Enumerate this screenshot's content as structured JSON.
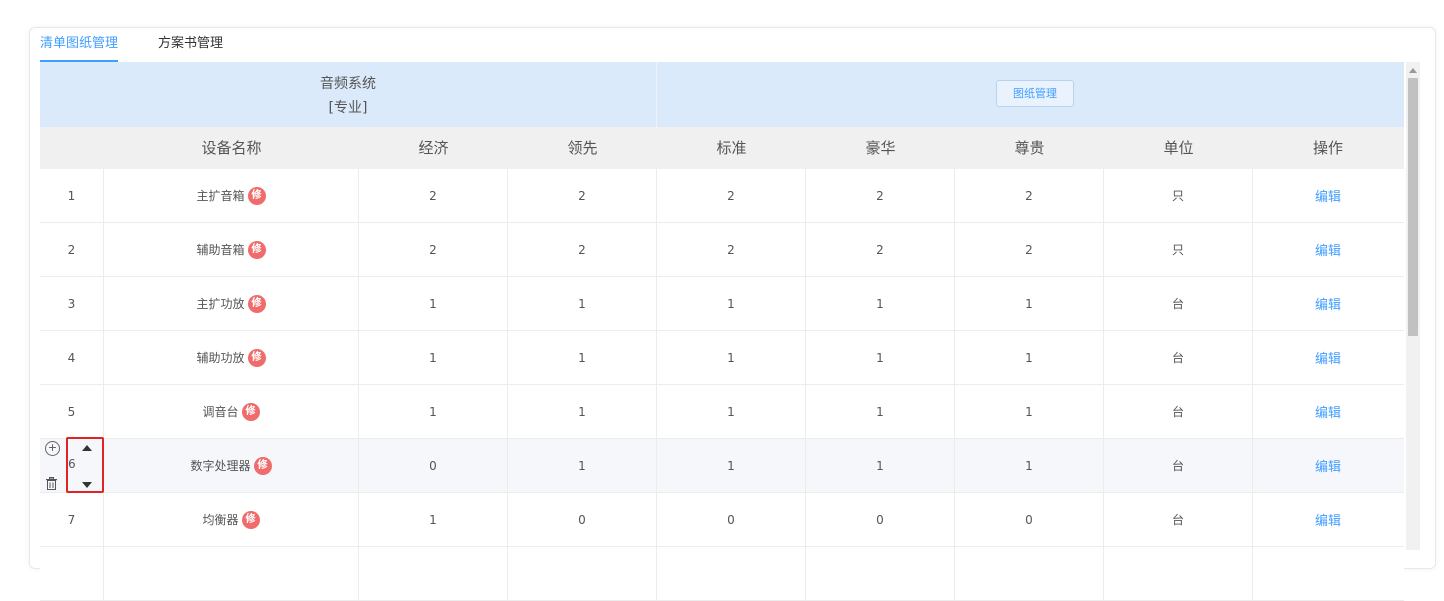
{
  "tabs": [
    {
      "label": "清单图纸管理",
      "active": true
    },
    {
      "label": "方案书管理",
      "active": false
    }
  ],
  "banner": {
    "system": "音频系统",
    "category": "[专业]",
    "drawings_button": "图纸管理"
  },
  "columns": [
    "",
    "设备名称",
    "经济",
    "领先",
    "标准",
    "豪华",
    "尊贵",
    "单位",
    "操作"
  ],
  "mod_badge": "修",
  "edit_label": "编辑",
  "rows": [
    {
      "index": "1",
      "name": "主扩音箱",
      "values": [
        "2",
        "2",
        "2",
        "2",
        "2"
      ],
      "unit": "只"
    },
    {
      "index": "2",
      "name": "辅助音箱",
      "values": [
        "2",
        "2",
        "2",
        "2",
        "2"
      ],
      "unit": "只"
    },
    {
      "index": "3",
      "name": "主扩功放",
      "values": [
        "1",
        "1",
        "1",
        "1",
        "1"
      ],
      "unit": "台"
    },
    {
      "index": "4",
      "name": "辅助功放",
      "values": [
        "1",
        "1",
        "1",
        "1",
        "1"
      ],
      "unit": "台"
    },
    {
      "index": "5",
      "name": "调音台",
      "values": [
        "1",
        "1",
        "1",
        "1",
        "1"
      ],
      "unit": "台"
    },
    {
      "index": "6",
      "name": "数字处理器",
      "values": [
        "0",
        "1",
        "1",
        "1",
        "1"
      ],
      "unit": "台"
    },
    {
      "index": "7",
      "name": "均衡器",
      "values": [
        "1",
        "0",
        "0",
        "0",
        "0"
      ],
      "unit": "台"
    }
  ],
  "colors": {
    "accent": "#409eff",
    "badge": "#f06b6b",
    "banner_bg": "#dbeafb",
    "highlight_box": "#e02424"
  }
}
